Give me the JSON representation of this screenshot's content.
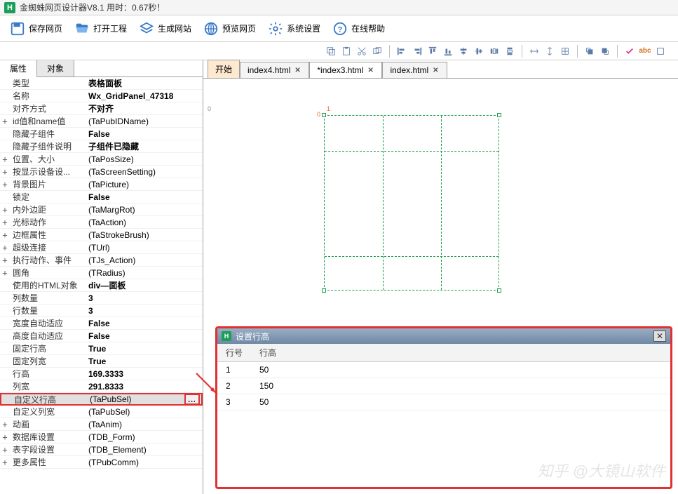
{
  "app": {
    "title": "金蜘蛛网页设计器V8.1 用时：0.67秒！"
  },
  "toolbar": {
    "save": "保存网页",
    "open": "打开工程",
    "gen": "生成网站",
    "preview": "预览网页",
    "settings": "系统设置",
    "help": "在线帮助"
  },
  "sideTabs": {
    "attr": "属性",
    "obj": "对象"
  },
  "props": [
    {
      "exp": "",
      "k": "类型",
      "v": "表格面板",
      "bold": true
    },
    {
      "exp": "",
      "k": "名称",
      "v": "Wx_GridPanel_47318",
      "bold": true
    },
    {
      "exp": "",
      "k": "对齐方式",
      "v": "不对齐",
      "bold": true
    },
    {
      "exp": "+",
      "k": "id值和name值",
      "v": "(TaPubIDName)"
    },
    {
      "exp": "",
      "k": "隐藏子组件",
      "v": "False",
      "bold": true
    },
    {
      "exp": "",
      "k": "隐藏子组件说明",
      "v": "子组件已隐藏",
      "bold": true
    },
    {
      "exp": "+",
      "k": "位置、大小",
      "v": "(TaPosSize)"
    },
    {
      "exp": "+",
      "k": "按显示设备设...",
      "v": "(TaScreenSetting)"
    },
    {
      "exp": "+",
      "k": "背景图片",
      "v": "(TaPicture)"
    },
    {
      "exp": "",
      "k": "锁定",
      "v": "False",
      "bold": true
    },
    {
      "exp": "+",
      "k": "内外边距",
      "v": "(TaMargRot)"
    },
    {
      "exp": "+",
      "k": "光标动作",
      "v": "(TaAction)"
    },
    {
      "exp": "+",
      "k": "边框属性",
      "v": "(TaStrokeBrush)"
    },
    {
      "exp": "+",
      "k": "超级连接",
      "v": "(TUrl)"
    },
    {
      "exp": "+",
      "k": "执行动作、事件",
      "v": "(TJs_Action)"
    },
    {
      "exp": "+",
      "k": "圆角",
      "v": "(TRadius)"
    },
    {
      "exp": "",
      "k": "使用的HTML对象",
      "v": "div—面板",
      "bold": true
    },
    {
      "exp": "",
      "k": "列数量",
      "v": "3",
      "bold": true
    },
    {
      "exp": "",
      "k": "行数量",
      "v": "3",
      "bold": true
    },
    {
      "exp": "",
      "k": "宽度自动适应",
      "v": "False",
      "bold": true
    },
    {
      "exp": "",
      "k": "高度自动适应",
      "v": "False",
      "bold": true
    },
    {
      "exp": "",
      "k": "固定行高",
      "v": "True",
      "bold": true
    },
    {
      "exp": "",
      "k": "固定列宽",
      "v": "True",
      "bold": true
    },
    {
      "exp": "",
      "k": "行高",
      "v": "169.3333",
      "bold": true
    },
    {
      "exp": "",
      "k": "列宽",
      "v": "291.8333",
      "bold": true
    },
    {
      "exp": "",
      "k": "自定义行高",
      "v": "(TaPubSel)",
      "sel": true
    },
    {
      "exp": "",
      "k": "自定义列宽",
      "v": "(TaPubSel)"
    },
    {
      "exp": "+",
      "k": "动画",
      "v": "(TaAnim)"
    },
    {
      "exp": "+",
      "k": "数据库设置",
      "v": "(TDB_Form)"
    },
    {
      "exp": "+",
      "k": "表字段设置",
      "v": "(TDB_Element)"
    },
    {
      "exp": "+",
      "k": "更多属性",
      "v": "(TPubComm)"
    }
  ],
  "docTabs": {
    "start": "开始",
    "tabs": [
      "index4.html",
      "*index3.html",
      "index.html"
    ]
  },
  "popup": {
    "title": "设置行高",
    "col1": "行号",
    "col2": "行高",
    "rows": [
      {
        "n": "1",
        "h": "50"
      },
      {
        "n": "2",
        "h": "150"
      },
      {
        "n": "3",
        "h": "50"
      }
    ]
  },
  "markers": {
    "zero1": "0",
    "zero2": "0",
    "one": "1"
  },
  "watermark": "知乎 @大镜山软件"
}
